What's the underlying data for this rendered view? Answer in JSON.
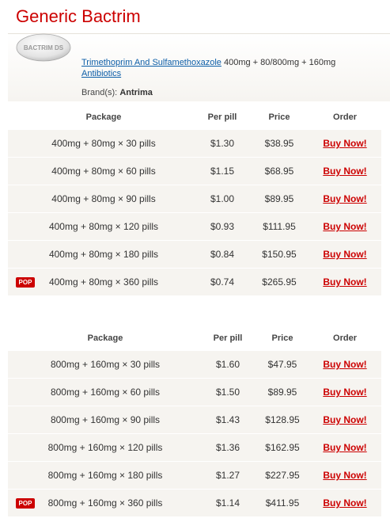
{
  "page": {
    "title": "Generic Bactrim"
  },
  "product": {
    "pill_label": "BACTRIM DS",
    "name_link": "Trimethoprim And Sulfamethoxazole",
    "dosages": "400mg + 80/800mg + 160mg",
    "category_link": "Antibiotics",
    "brand_label": "Brand(s):",
    "brand_value": "Antrima"
  },
  "tables": [
    {
      "headers": {
        "package": "Package",
        "per_pill": "Per pill",
        "price": "Price",
        "order": "Order"
      },
      "rows": [
        {
          "package": "400mg + 80mg × 30 pills",
          "per_pill": "$1.30",
          "price": "$38.95",
          "order": "Buy Now!",
          "pop": ""
        },
        {
          "package": "400mg + 80mg × 60 pills",
          "per_pill": "$1.15",
          "price": "$68.95",
          "order": "Buy Now!",
          "pop": ""
        },
        {
          "package": "400mg + 80mg × 90 pills",
          "per_pill": "$1.00",
          "price": "$89.95",
          "order": "Buy Now!",
          "pop": ""
        },
        {
          "package": "400mg + 80mg × 120 pills",
          "per_pill": "$0.93",
          "price": "$111.95",
          "order": "Buy Now!",
          "pop": ""
        },
        {
          "package": "400mg + 80mg × 180 pills",
          "per_pill": "$0.84",
          "price": "$150.95",
          "order": "Buy Now!",
          "pop": ""
        },
        {
          "package": "400mg + 80mg × 360 pills",
          "per_pill": "$0.74",
          "price": "$265.95",
          "order": "Buy Now!",
          "pop": "POP"
        }
      ]
    },
    {
      "headers": {
        "package": "Package",
        "per_pill": "Per pill",
        "price": "Price",
        "order": "Order"
      },
      "rows": [
        {
          "package": "800mg + 160mg × 30 pills",
          "per_pill": "$1.60",
          "price": "$47.95",
          "order": "Buy Now!",
          "pop": ""
        },
        {
          "package": "800mg + 160mg × 60 pills",
          "per_pill": "$1.50",
          "price": "$89.95",
          "order": "Buy Now!",
          "pop": ""
        },
        {
          "package": "800mg + 160mg × 90 pills",
          "per_pill": "$1.43",
          "price": "$128.95",
          "order": "Buy Now!",
          "pop": ""
        },
        {
          "package": "800mg + 160mg × 120 pills",
          "per_pill": "$1.36",
          "price": "$162.95",
          "order": "Buy Now!",
          "pop": ""
        },
        {
          "package": "800mg + 160mg × 180 pills",
          "per_pill": "$1.27",
          "price": "$227.95",
          "order": "Buy Now!",
          "pop": ""
        },
        {
          "package": "800mg + 160mg × 360 pills",
          "per_pill": "$1.14",
          "price": "$411.95",
          "order": "Buy Now!",
          "pop": "POP"
        }
      ]
    }
  ]
}
